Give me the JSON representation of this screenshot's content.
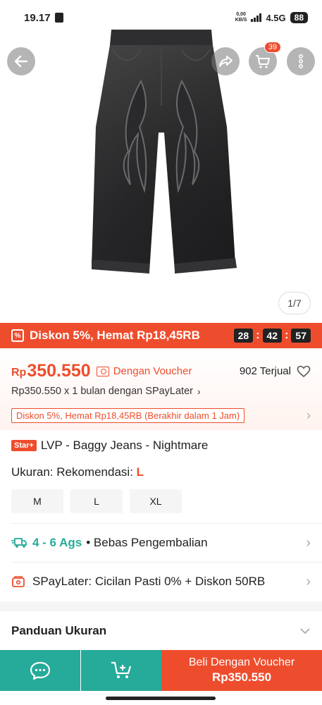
{
  "status_bar": {
    "time": "19.17",
    "net_speed_top": "0,00",
    "net_speed_unit": "KB/S",
    "network": "4.5G",
    "battery": "88"
  },
  "hero": {
    "image_counter": "1/7",
    "cart_badge": "39",
    "icons": [
      "back-arrow-icon",
      "share-icon",
      "cart-icon",
      "more-vertical-icon"
    ]
  },
  "flash": {
    "text": "Diskon 5%, Hemat Rp18,45RB",
    "timer": [
      "28",
      "42",
      "57"
    ]
  },
  "price": {
    "currency": "Rp",
    "value": "350.550",
    "voucher_label": "Dengan Voucher",
    "sold": "902 Terjual",
    "paylater": "Rp350.550 x 1 bulan dengan SPayLater",
    "discount_tag": "Diskon 5%, Hemat Rp18,45RB (Berakhir dalam 1 Jam)"
  },
  "product": {
    "star_tag": "Star+",
    "title": "LVP - Baggy Jeans - Nightmare",
    "size_label": "Ukuran: Rekomendasi:",
    "size_rec": "L",
    "sizes": [
      "M",
      "L",
      "XL"
    ]
  },
  "shipping": {
    "days": "4 - 6 Ags",
    "text": "• Bebas Pengembalian"
  },
  "spaylater_row": "SPayLater: Cicilan Pasti 0% + Diskon 50RB",
  "size_guide": "Panduan Ukuran",
  "bottom_bar": {
    "buy_line1": "Beli Dengan Voucher",
    "buy_line2": "Rp350.550"
  },
  "colors": {
    "accent": "#ee4d2d",
    "teal": "#26aa99"
  }
}
